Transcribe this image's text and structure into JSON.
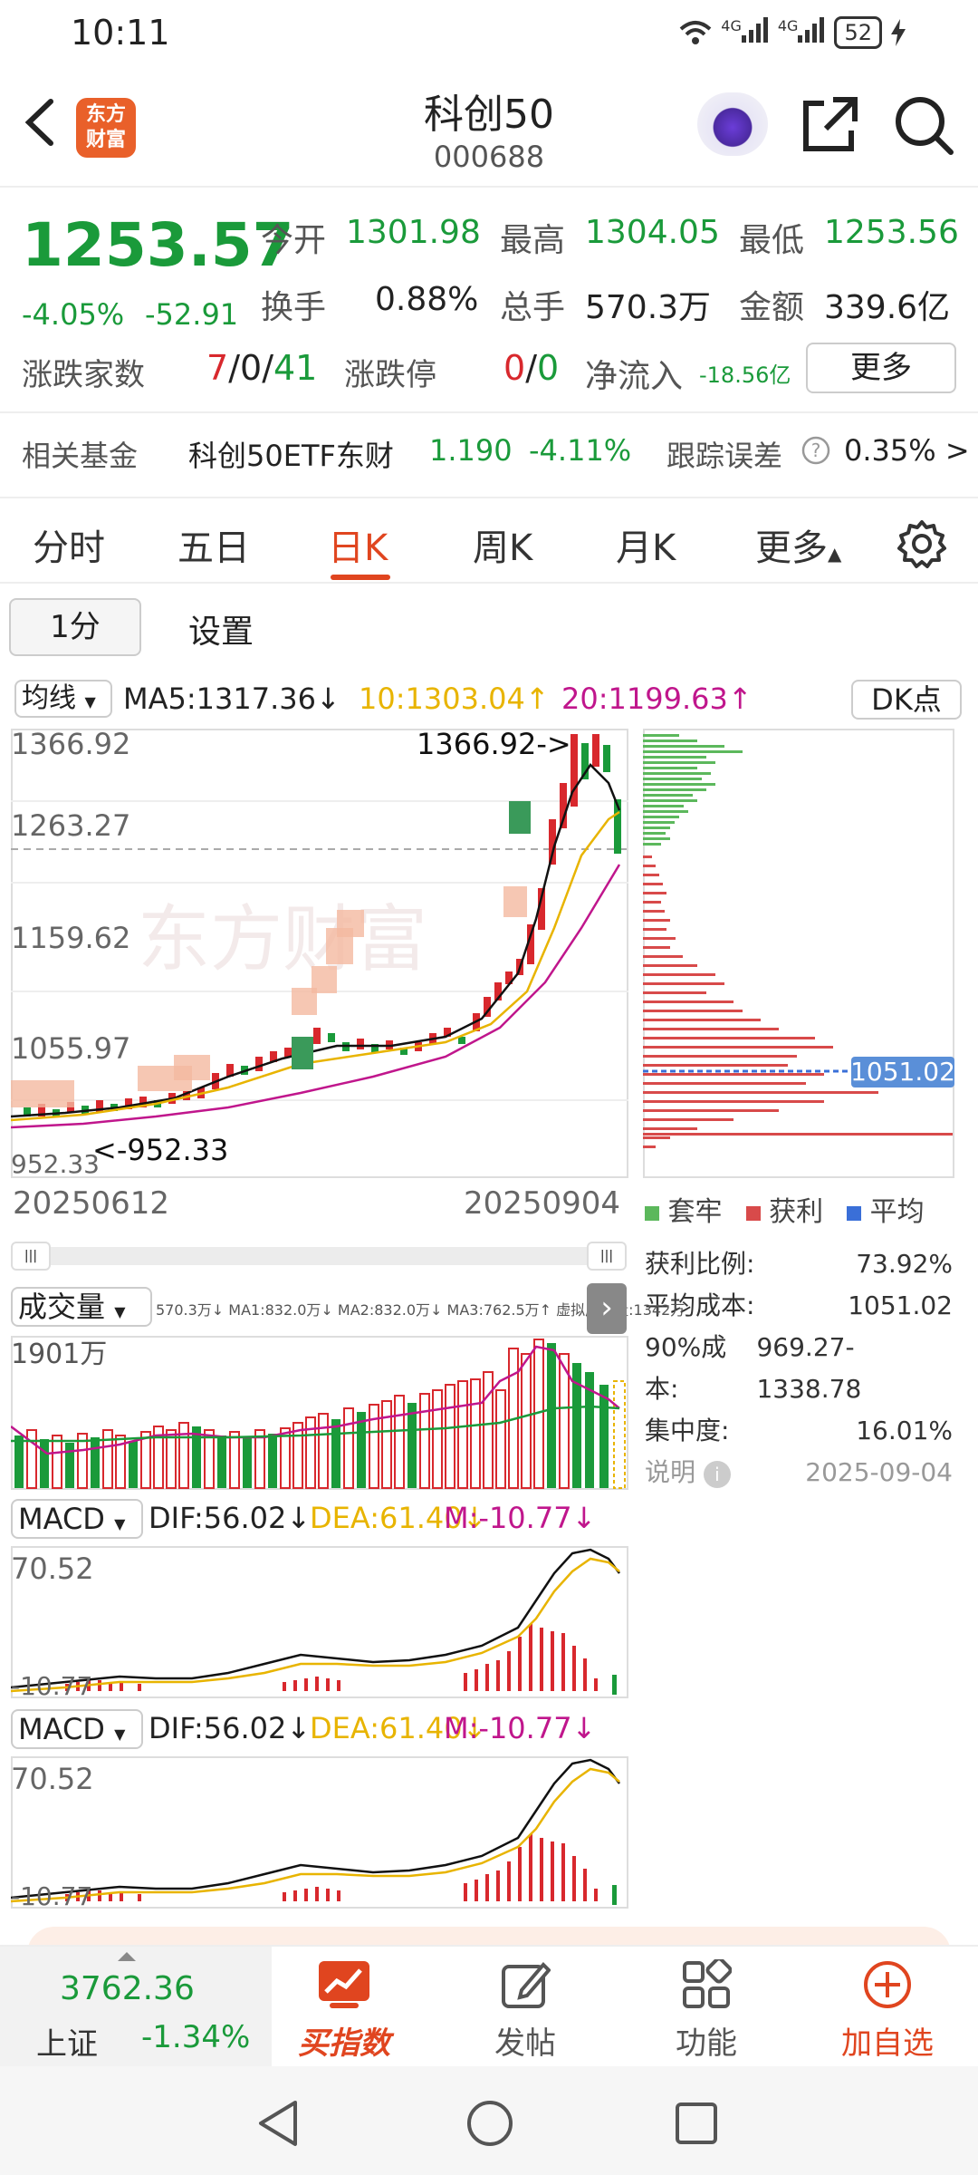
{
  "status": {
    "time": "10:11",
    "signal1": "4G",
    "signal2": "4G",
    "battery": "52"
  },
  "header": {
    "logo_line1": "东方",
    "logo_line2": "财富",
    "title": "科创50",
    "code": "000688"
  },
  "quote": {
    "price": "1253.57",
    "change_pct": "-4.05%",
    "change_amt": "-52.91",
    "open_label": "今开",
    "open": "1301.98",
    "high_label": "最高",
    "high": "1304.05",
    "low_label": "最低",
    "low": "1253.56",
    "turnover_label": "换手",
    "turnover": "0.88%",
    "volume_label": "总手",
    "volume": "570.3万",
    "amount_label": "金额",
    "amount": "339.6亿",
    "breadth_label": "涨跌家数",
    "breadth_up": "7",
    "breadth_flat": "0",
    "breadth_down": "41",
    "limit_label": "涨跌停",
    "limit_up": "0",
    "limit_down": "0",
    "inflow_label": "净流入",
    "inflow": "-18.56亿",
    "more_label": "更多",
    "fund_label": "相关基金",
    "fund_name": "科创50ETF东财",
    "fund_price": "1.190",
    "fund_chg": "-4.11%",
    "tracking_label": "跟踪误差",
    "tracking": "0.35% >"
  },
  "tabs": [
    "分时",
    "五日",
    "日K",
    "周K",
    "月K",
    "更多"
  ],
  "period": {
    "selected": "1分",
    "settings": "设置"
  },
  "ma_bar": {
    "type": "均线",
    "ma5": "MA5:1317.36↓",
    "ma10": "10:1303.04↑",
    "ma20": "20:1199.63↑",
    "dk": "DK点"
  },
  "kline": {
    "y_labels": [
      "1366.92",
      "1263.27",
      "1159.62",
      "1055.97",
      "952.33"
    ],
    "start_date": "20250612",
    "end_date": "20250904",
    "high_marker": "1366.92->",
    "low_marker": "<-952.33",
    "watermark": "东方财富"
  },
  "chip": {
    "avg_label": "1051.02",
    "legend": [
      "套牢",
      "获利",
      "平均"
    ],
    "profit_ratio_label": "获利比例:",
    "profit_ratio": "73.92%",
    "avg_cost_label": "平均成本:",
    "avg_cost": "1051.02",
    "cost90_label": "90%成本:",
    "cost90": "969.27-1338.78",
    "concentration_label": "集中度:",
    "concentration": "16.01%",
    "note_label": "说明",
    "date": "2025-09-04"
  },
  "volume_bar": {
    "label": "成交量",
    "info": "570.3万↓ MA1:832.0万↓ MA2:832.0万↓ MA3:762.5万↑ 虚拟成交量:1342万",
    "max": "1901万"
  },
  "macd1": {
    "label": "MACD",
    "dif": "DIF:56.02↓",
    "dea": "DEA:61.40↓",
    "m": "M:-10.77↓",
    "top": "70.52",
    "bottom": "-10.77"
  },
  "macd2": {
    "label": "MACD",
    "dif": "DIF:56.02↓",
    "dea": "DEA:61.40↓",
    "m": "M:-10.77↓",
    "top": "70.52",
    "bottom": "-10.77"
  },
  "bottom_nav": {
    "index_value": "3762.36",
    "index_name": "上证",
    "index_chg": "-1.34%",
    "buy_index": "买指数",
    "post": "发帖",
    "functions": "功能",
    "add_watch": "加自选"
  },
  "colors": {
    "up": "#d8282d",
    "down": "#1a9a3a",
    "accent": "#e0451f",
    "ma10": "#e8b400",
    "ma20": "#c0168c"
  }
}
